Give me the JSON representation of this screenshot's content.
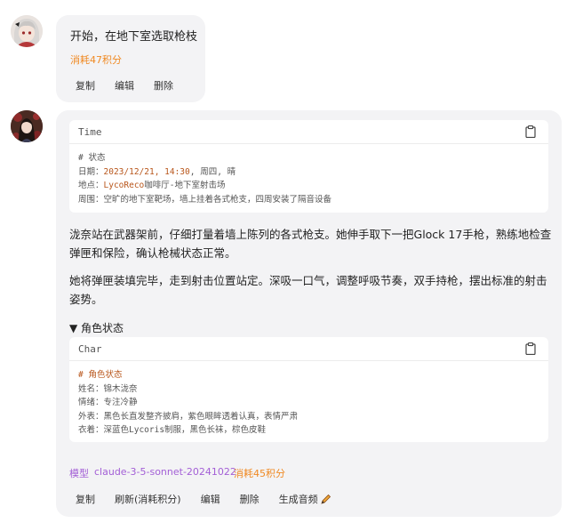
{
  "user_message": {
    "text": "开始，在地下室选取枪枝",
    "cost": "消耗47积分",
    "actions": [
      "复制",
      "编辑",
      "删除"
    ]
  },
  "ai_message": {
    "time_block": {
      "lang": "Time",
      "lines": [
        "# 状态",
        "日期：",
        "2023/12/21, 14:30",
        ", 周四, 晴",
        "地点：",
        "LycoReco",
        "咖啡厅-地下室射击场",
        "周围：空旷的地下室靶场，墙上挂着各式枪支，四周安装了隔音设备"
      ]
    },
    "paragraphs": [
      "泷奈站在武器架前，仔细打量着墙上陈列的各式枪支。她伸手取下一把Glock 17手枪，熟练地检查弹匣和保险，确认枪械状态正常。",
      "她将弹匣装填完毕，走到射击位置站定。深吸一口气，调整呼吸节奏，双手持枪，摆出标准的射击姿势。"
    ],
    "details_summary": "▼ 角色状态",
    "char_block": {
      "lang": "Char",
      "lines": [
        "# 角色状态",
        "姓名：锦木泷奈",
        "情绪：专注冷静",
        "外表：黑色长直发整齐披肩，紫色眼眸透着认真，表情严肃",
        "衣着：深蓝色Lycoris制服，黑色长袜，棕色皮鞋"
      ]
    },
    "model_label": "模型",
    "model_name": "claude-3-5-sonnet-20241022",
    "cost": "消耗45积分",
    "actions": [
      "复制",
      "刷新(消耗积分)",
      "编辑",
      "删除",
      "生成音频"
    ],
    "audio_icon": "pencil-icon"
  },
  "colors": {
    "bubble": "#f3f3f5",
    "cost": "#f08a24",
    "model": "#a35fd6",
    "highlight": "#b8561b"
  }
}
